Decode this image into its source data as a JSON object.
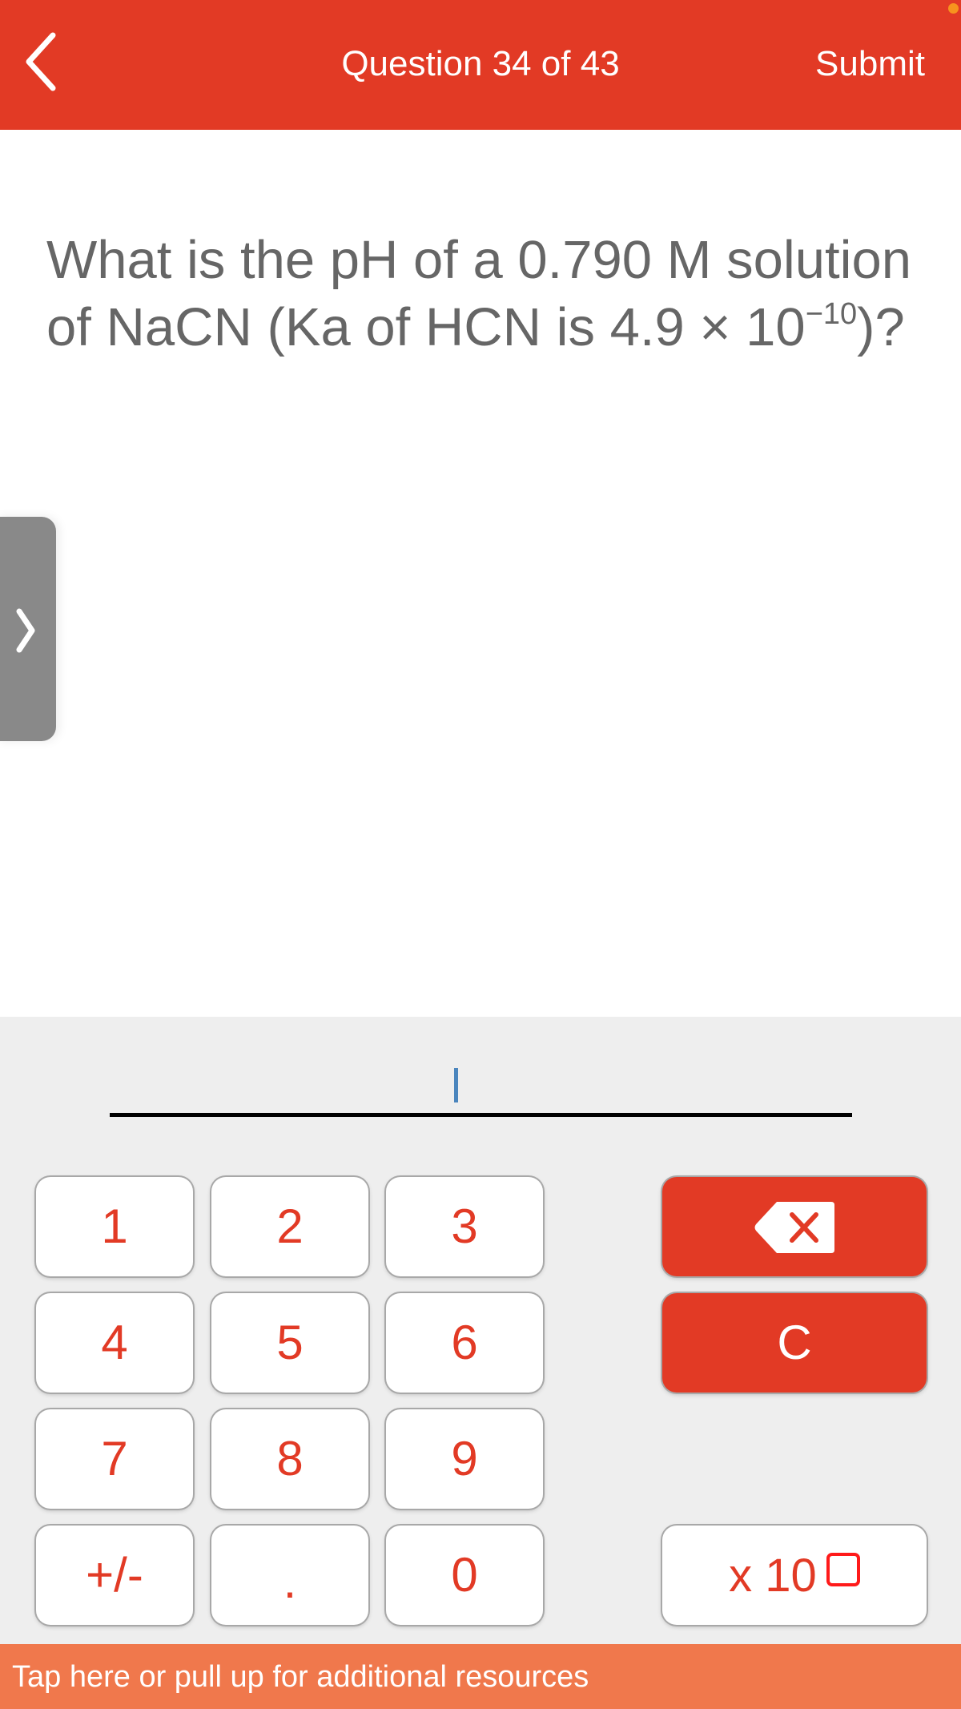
{
  "header": {
    "back_icon": "chevron-left-icon",
    "title": "Question 34 of 43",
    "submit_label": "Submit"
  },
  "question": {
    "text_before": "What is the pH of a 0.790 M solution of NaCN (Ka of HCN is  4.9 × 10",
    "exponent": "−10",
    "text_after": ")?"
  },
  "side_tab": {
    "icon": "chevron-right-icon"
  },
  "answer": {
    "value": "",
    "placeholder": ""
  },
  "keypad": {
    "keys": [
      "1",
      "2",
      "3",
      "4",
      "5",
      "6",
      "7",
      "8",
      "9",
      "+/-",
      ".",
      "0"
    ],
    "backspace_icon": "backspace-icon",
    "clear_label": "C",
    "x10_label": "x 10",
    "x10_box_icon": "exponent-box-icon"
  },
  "footer": {
    "text": "Tap here or pull up for additional resources"
  },
  "colors": {
    "brand_red": "#e23a25",
    "footer_orange": "#f0784c",
    "keypad_bg": "#eeeeee",
    "question_text": "#666666",
    "cursor_blue": "#4a85bd",
    "status_dot": "#f7931e"
  }
}
